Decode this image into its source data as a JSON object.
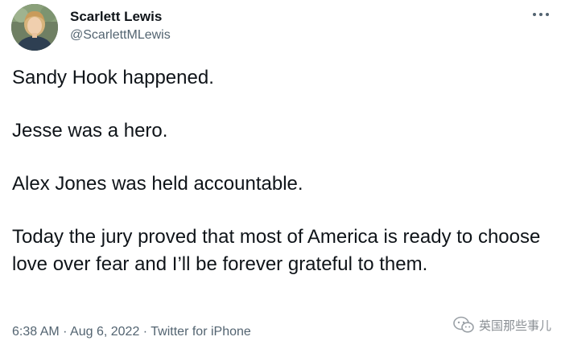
{
  "tweet": {
    "display_name": "Scarlett Lewis",
    "handle": "@ScarlettMLewis",
    "paragraphs": [
      "Sandy Hook happened.",
      "Jesse was a hero.",
      "Alex Jones was held accountable.",
      "Today the jury proved that most of America is ready to choose love over fear and I’ll be forever grateful to them."
    ],
    "time": "6:38 AM",
    "separator": "·",
    "date": "Aug 6, 2022",
    "source": "Twitter for iPhone"
  },
  "watermark": {
    "text": "英国那些事儿",
    "icon": "wechat-icon"
  },
  "icons": {
    "more": "more-horizontal-icon",
    "avatar": "avatar-photo"
  },
  "colors": {
    "text_primary": "#0f1419",
    "text_secondary": "#536471",
    "watermark": "#8a8f94"
  }
}
